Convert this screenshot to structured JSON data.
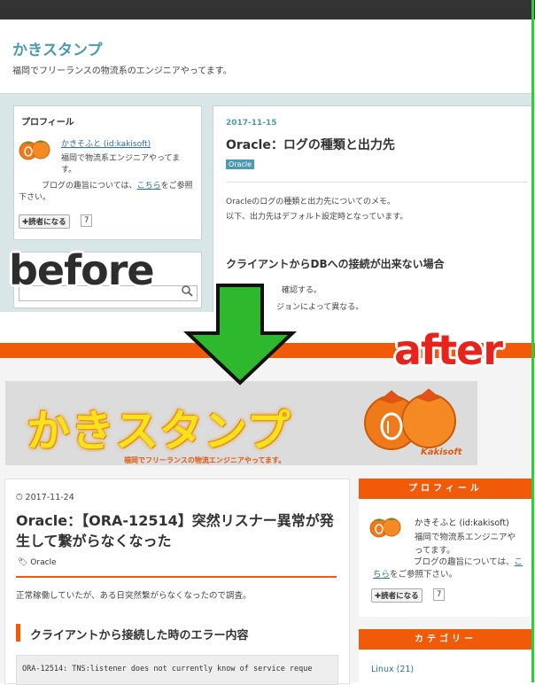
{
  "labels": {
    "before": "before",
    "after": "after"
  },
  "before": {
    "blog_title": "かきスタンプ",
    "tagline": "福岡でフリーランスの物流系のエンジニアやってます。",
    "profile": {
      "heading": "プロフィール",
      "username": "かきそふと (id:kakisoft)",
      "desc1": "福岡で物流系エンジニアやってます。",
      "desc2": "ます。",
      "blog_pre": "ブログの趣旨については、",
      "blog_link": "こちら",
      "blog_post": "をご参照下さい。",
      "reader_button": "✚読者になる",
      "reader_count": "7"
    },
    "post": {
      "date": "2017-11-15",
      "title": "Oracle：ログの種類と出力先",
      "category": "Oracle",
      "p1": "Oracleのログの種類と出力先についてのメモ。",
      "p2": "以下、出力先はデフォルト設定時となっています。",
      "h2": "クライアントからDBへの接続が出来ない場合",
      "p3": "確認する。",
      "p4": "ジョンによって異なる。"
    }
  },
  "after": {
    "logo_text": "かきスタンプ",
    "logo_sub": "福岡でフリーランスの物流エンジニアやってます。",
    "logo_brand": "Kakisoft",
    "post": {
      "date": "2017-11-24",
      "title": "Oracle：【ORA-12514】突然リスナー異常が発生して繋がらなくなった",
      "tag": "Oracle",
      "intro": "正常稼働していたが、ある日突然繋がらなくなったので調査。",
      "h2": "クライアントから接続した時のエラー内容",
      "code": "ORA-12514: TNS:listener does not currently know of service reque"
    },
    "profile": {
      "heading": "プロフィール",
      "username": "かきそふと (id:kakisoft)",
      "desc1": "福岡で物流系エンジニアや",
      "desc2": "ってます。",
      "blog_pre": "ブログの趣旨については、",
      "blog_link": "こちら",
      "blog_post": "をご参照下さい。",
      "reader_button": "✚読者になる",
      "reader_count": "7"
    },
    "category": {
      "heading": "カテゴリー",
      "first_item": "Linux (21)"
    }
  },
  "colors": {
    "before_accent": "#4a9bb0",
    "after_accent": "#f15a09",
    "arrow": "#2db82d",
    "after_label": "#e8231b"
  }
}
